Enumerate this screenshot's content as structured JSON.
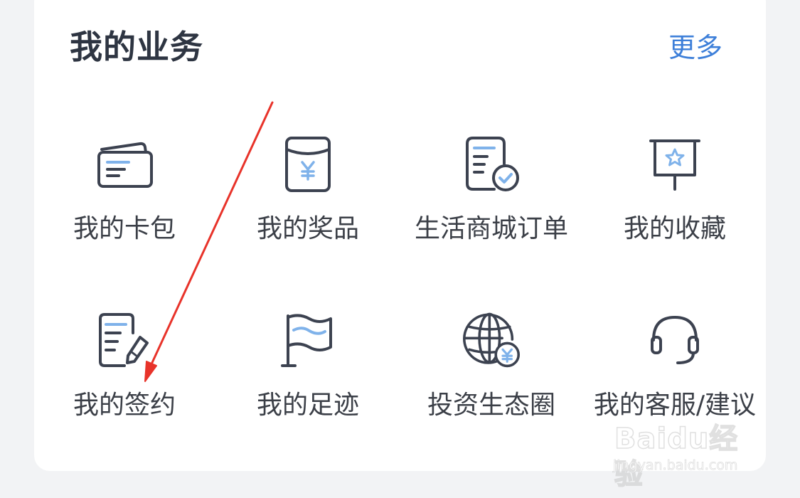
{
  "section": {
    "title": "我的业务",
    "more_label": "更多"
  },
  "colors": {
    "icon_stroke": "#3c4250",
    "icon_accent": "#7fb2ea",
    "more_link": "#3d7fd9",
    "arrow": "#e8332a"
  },
  "items": [
    {
      "label": "我的卡包",
      "icon": "card-wallet-icon"
    },
    {
      "label": "我的奖品",
      "icon": "prize-envelope-icon"
    },
    {
      "label": "生活商城订单",
      "icon": "order-document-check-icon"
    },
    {
      "label": "我的收藏",
      "icon": "favorite-star-board-icon"
    },
    {
      "label": "我的签约",
      "icon": "contract-sign-icon"
    },
    {
      "label": "我的足迹",
      "icon": "footprint-flag-icon"
    },
    {
      "label": "投资生态圈",
      "icon": "investment-globe-icon"
    },
    {
      "label": "我的客服/建议",
      "icon": "customer-service-headset-icon"
    }
  ],
  "watermark": {
    "brand": "Baidu经验",
    "url": "jingyan.baidu.com"
  }
}
